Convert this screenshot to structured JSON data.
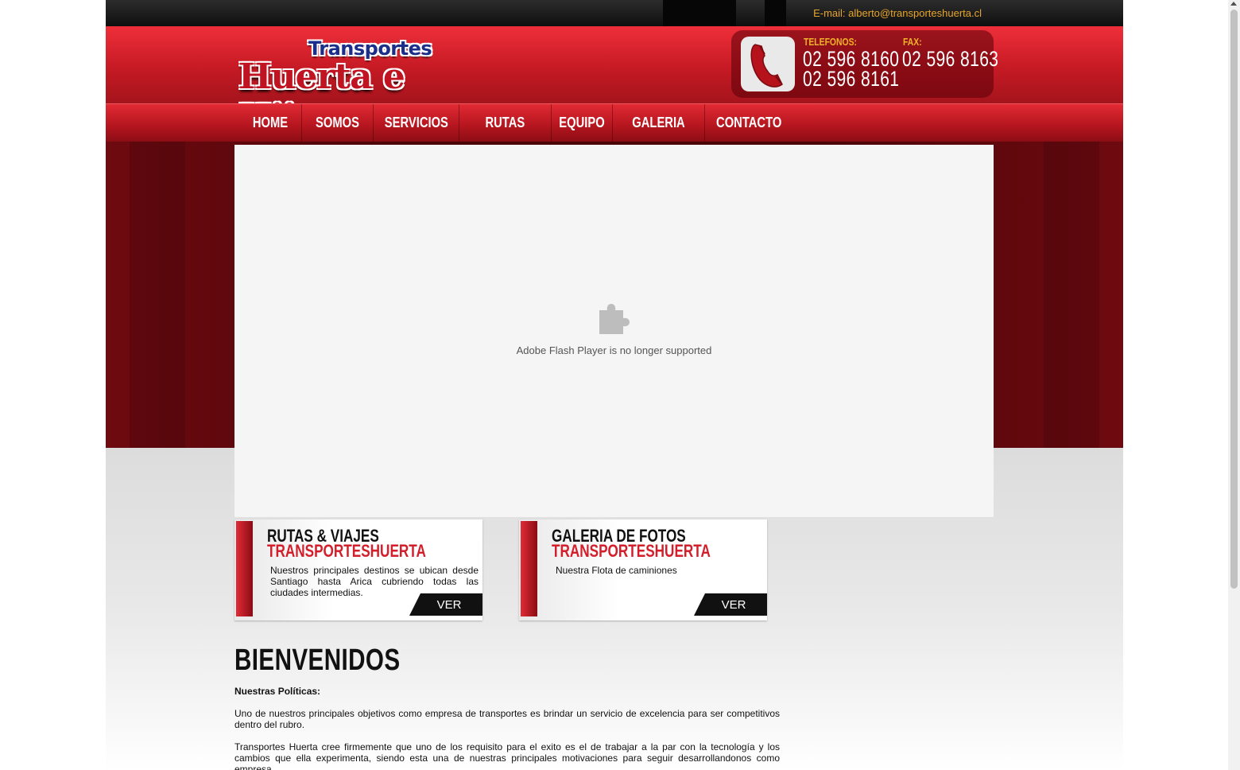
{
  "topbar": {
    "email_label": "E-mail:",
    "email": "alberto@transporteshuerta.cl"
  },
  "header": {
    "logo_line1": "Transportes",
    "logo_line2": "Huerta e Hijo",
    "phones_label": "TELEFONOS:",
    "phone1": "02 596 8160",
    "phone2": "02 596 8161",
    "fax_label": "FAX:",
    "fax": "02 596 8163",
    "icon": "phone-icon"
  },
  "nav": {
    "items": [
      "HOME",
      "SOMOS",
      "SERVICIOS",
      "RUTAS",
      "EQUIPO",
      "GALERIA",
      "CONTACTO"
    ]
  },
  "flash": {
    "message": "Adobe Flash Player is no longer supported",
    "icon": "plugin-icon"
  },
  "boxes": [
    {
      "title": "RUTAS & VIAJES",
      "subtitle": "TRANSPORTESHUERTA",
      "description": "Nuestros principales destinos se ubican desde Santiago hasta Arica cubriendo todas las ciudades intermedias.",
      "button": "VER"
    },
    {
      "title": "GALERIA DE FOTOS",
      "subtitle": "TRANSPORTESHUERTA",
      "description": "Nuestra Flota de caminiones",
      "button": "VER"
    }
  ],
  "welcome": {
    "title": "BIENVENIDOS",
    "subtitle": "Nuestras Políticas:",
    "paragraphs": [
      "Uno de nuestros principales objetivos como empresa de transportes es brindar un servicio de excelencia para ser competitivos dentro del rubro.",
      "Transportes Huerta cree firmemente que uno de los requisito para el exito es el de trabajar a la par con la tecnología y los cambios que ella experimenta, siendo esta una de nuestras principales motivaciones para seguir desarrollandonos como empresa."
    ]
  },
  "colors": {
    "brand_red": "#d21f2b",
    "dark_red": "#4a0508",
    "accent_gold": "#e6a52a"
  }
}
